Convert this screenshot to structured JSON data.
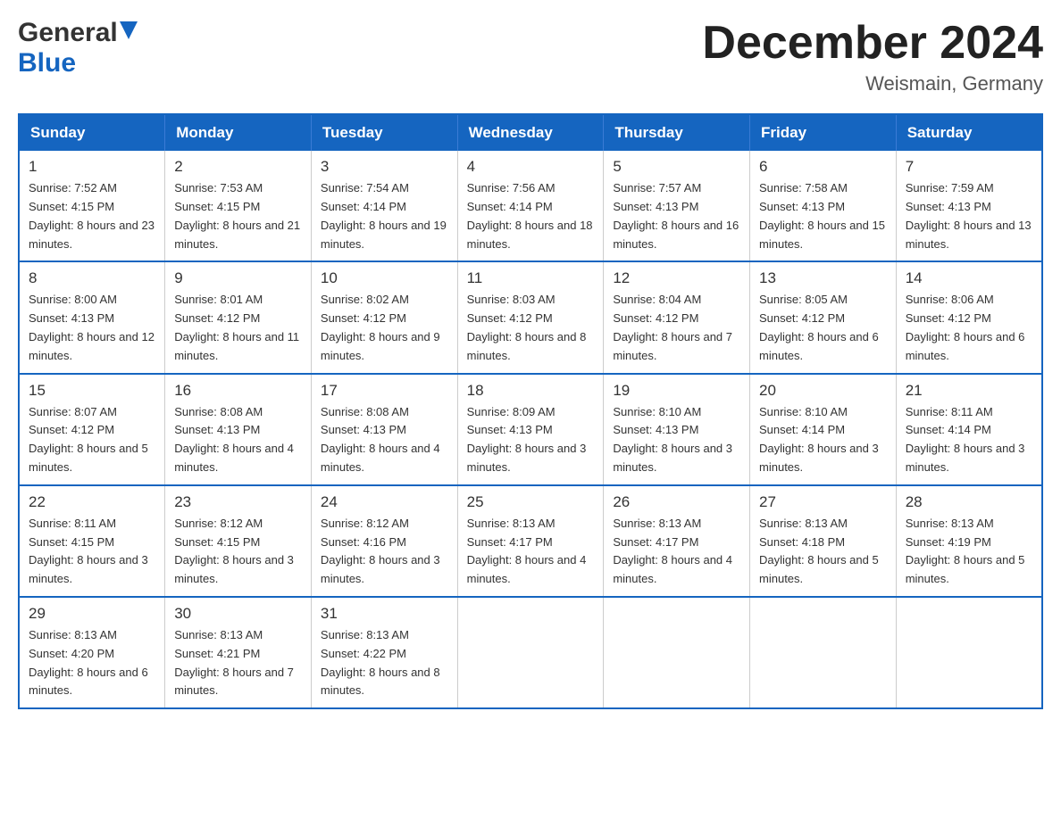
{
  "header": {
    "logo_general": "General",
    "logo_blue": "Blue",
    "title": "December 2024",
    "subtitle": "Weismain, Germany"
  },
  "days_of_week": [
    "Sunday",
    "Monday",
    "Tuesday",
    "Wednesday",
    "Thursday",
    "Friday",
    "Saturday"
  ],
  "weeks": [
    [
      {
        "day": "1",
        "sunrise": "7:52 AM",
        "sunset": "4:15 PM",
        "daylight": "8 hours and 23 minutes."
      },
      {
        "day": "2",
        "sunrise": "7:53 AM",
        "sunset": "4:15 PM",
        "daylight": "8 hours and 21 minutes."
      },
      {
        "day": "3",
        "sunrise": "7:54 AM",
        "sunset": "4:14 PM",
        "daylight": "8 hours and 19 minutes."
      },
      {
        "day": "4",
        "sunrise": "7:56 AM",
        "sunset": "4:14 PM",
        "daylight": "8 hours and 18 minutes."
      },
      {
        "day": "5",
        "sunrise": "7:57 AM",
        "sunset": "4:13 PM",
        "daylight": "8 hours and 16 minutes."
      },
      {
        "day": "6",
        "sunrise": "7:58 AM",
        "sunset": "4:13 PM",
        "daylight": "8 hours and 15 minutes."
      },
      {
        "day": "7",
        "sunrise": "7:59 AM",
        "sunset": "4:13 PM",
        "daylight": "8 hours and 13 minutes."
      }
    ],
    [
      {
        "day": "8",
        "sunrise": "8:00 AM",
        "sunset": "4:13 PM",
        "daylight": "8 hours and 12 minutes."
      },
      {
        "day": "9",
        "sunrise": "8:01 AM",
        "sunset": "4:12 PM",
        "daylight": "8 hours and 11 minutes."
      },
      {
        "day": "10",
        "sunrise": "8:02 AM",
        "sunset": "4:12 PM",
        "daylight": "8 hours and 9 minutes."
      },
      {
        "day": "11",
        "sunrise": "8:03 AM",
        "sunset": "4:12 PM",
        "daylight": "8 hours and 8 minutes."
      },
      {
        "day": "12",
        "sunrise": "8:04 AM",
        "sunset": "4:12 PM",
        "daylight": "8 hours and 7 minutes."
      },
      {
        "day": "13",
        "sunrise": "8:05 AM",
        "sunset": "4:12 PM",
        "daylight": "8 hours and 6 minutes."
      },
      {
        "day": "14",
        "sunrise": "8:06 AM",
        "sunset": "4:12 PM",
        "daylight": "8 hours and 6 minutes."
      }
    ],
    [
      {
        "day": "15",
        "sunrise": "8:07 AM",
        "sunset": "4:12 PM",
        "daylight": "8 hours and 5 minutes."
      },
      {
        "day": "16",
        "sunrise": "8:08 AM",
        "sunset": "4:13 PM",
        "daylight": "8 hours and 4 minutes."
      },
      {
        "day": "17",
        "sunrise": "8:08 AM",
        "sunset": "4:13 PM",
        "daylight": "8 hours and 4 minutes."
      },
      {
        "day": "18",
        "sunrise": "8:09 AM",
        "sunset": "4:13 PM",
        "daylight": "8 hours and 3 minutes."
      },
      {
        "day": "19",
        "sunrise": "8:10 AM",
        "sunset": "4:13 PM",
        "daylight": "8 hours and 3 minutes."
      },
      {
        "day": "20",
        "sunrise": "8:10 AM",
        "sunset": "4:14 PM",
        "daylight": "8 hours and 3 minutes."
      },
      {
        "day": "21",
        "sunrise": "8:11 AM",
        "sunset": "4:14 PM",
        "daylight": "8 hours and 3 minutes."
      }
    ],
    [
      {
        "day": "22",
        "sunrise": "8:11 AM",
        "sunset": "4:15 PM",
        "daylight": "8 hours and 3 minutes."
      },
      {
        "day": "23",
        "sunrise": "8:12 AM",
        "sunset": "4:15 PM",
        "daylight": "8 hours and 3 minutes."
      },
      {
        "day": "24",
        "sunrise": "8:12 AM",
        "sunset": "4:16 PM",
        "daylight": "8 hours and 3 minutes."
      },
      {
        "day": "25",
        "sunrise": "8:13 AM",
        "sunset": "4:17 PM",
        "daylight": "8 hours and 4 minutes."
      },
      {
        "day": "26",
        "sunrise": "8:13 AM",
        "sunset": "4:17 PM",
        "daylight": "8 hours and 4 minutes."
      },
      {
        "day": "27",
        "sunrise": "8:13 AM",
        "sunset": "4:18 PM",
        "daylight": "8 hours and 5 minutes."
      },
      {
        "day": "28",
        "sunrise": "8:13 AM",
        "sunset": "4:19 PM",
        "daylight": "8 hours and 5 minutes."
      }
    ],
    [
      {
        "day": "29",
        "sunrise": "8:13 AM",
        "sunset": "4:20 PM",
        "daylight": "8 hours and 6 minutes."
      },
      {
        "day": "30",
        "sunrise": "8:13 AM",
        "sunset": "4:21 PM",
        "daylight": "8 hours and 7 minutes."
      },
      {
        "day": "31",
        "sunrise": "8:13 AM",
        "sunset": "4:22 PM",
        "daylight": "8 hours and 8 minutes."
      },
      null,
      null,
      null,
      null
    ]
  ],
  "labels": {
    "sunrise_prefix": "Sunrise: ",
    "sunset_prefix": "Sunset: ",
    "daylight_prefix": "Daylight: "
  }
}
